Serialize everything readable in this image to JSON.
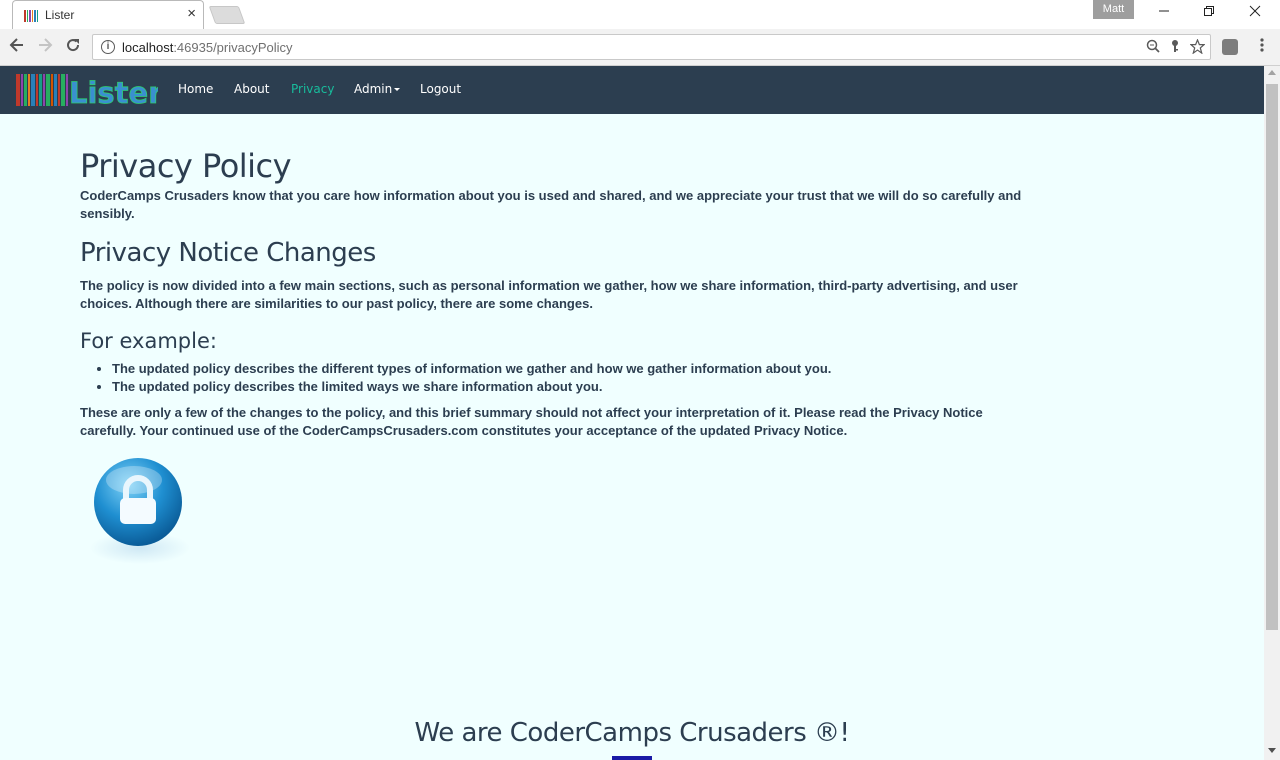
{
  "browser": {
    "tab_title": "Lister",
    "tab_close": "×",
    "profile_name": "Matt",
    "url_host": "localhost",
    "url_path": ":46935/privacyPolicy"
  },
  "navbar": {
    "brand": "Lister",
    "items": [
      {
        "label": "Home"
      },
      {
        "label": "About"
      },
      {
        "label": "Privacy",
        "active": true
      },
      {
        "label": "Admin"
      },
      {
        "label": "Logout"
      }
    ],
    "colors": {
      "background": "#2c3e50",
      "active": "#18bc9c"
    }
  },
  "page": {
    "title": "Privacy Policy",
    "intro": "CoderCamps Crusaders know that you care how information about you is used and shared, and we appreciate your trust that we will do so carefully and sensibly.",
    "changes_heading": "Privacy Notice Changes",
    "changes_text": "The policy is now divided into a few main sections, such as personal information we gather, how we share information, third-party advertising, and user choices. Although there are similarities to our past policy, there are some changes.",
    "example_heading": "For example:",
    "examples": [
      "The updated policy describes the different types of information we gather and how we gather information about you.",
      "The updated policy describes the limited ways we share information about you."
    ],
    "closing": "These are only a few of the changes to the policy, and this brief summary should not affect your interpretation of it. Please read the Privacy Notice carefully. Your continued use of the CoderCampsCrusaders.com constitutes your acceptance of the updated Privacy Notice.",
    "image_icon": "padlock-icon",
    "footer": "We are CoderCamps Crusaders ®!"
  }
}
